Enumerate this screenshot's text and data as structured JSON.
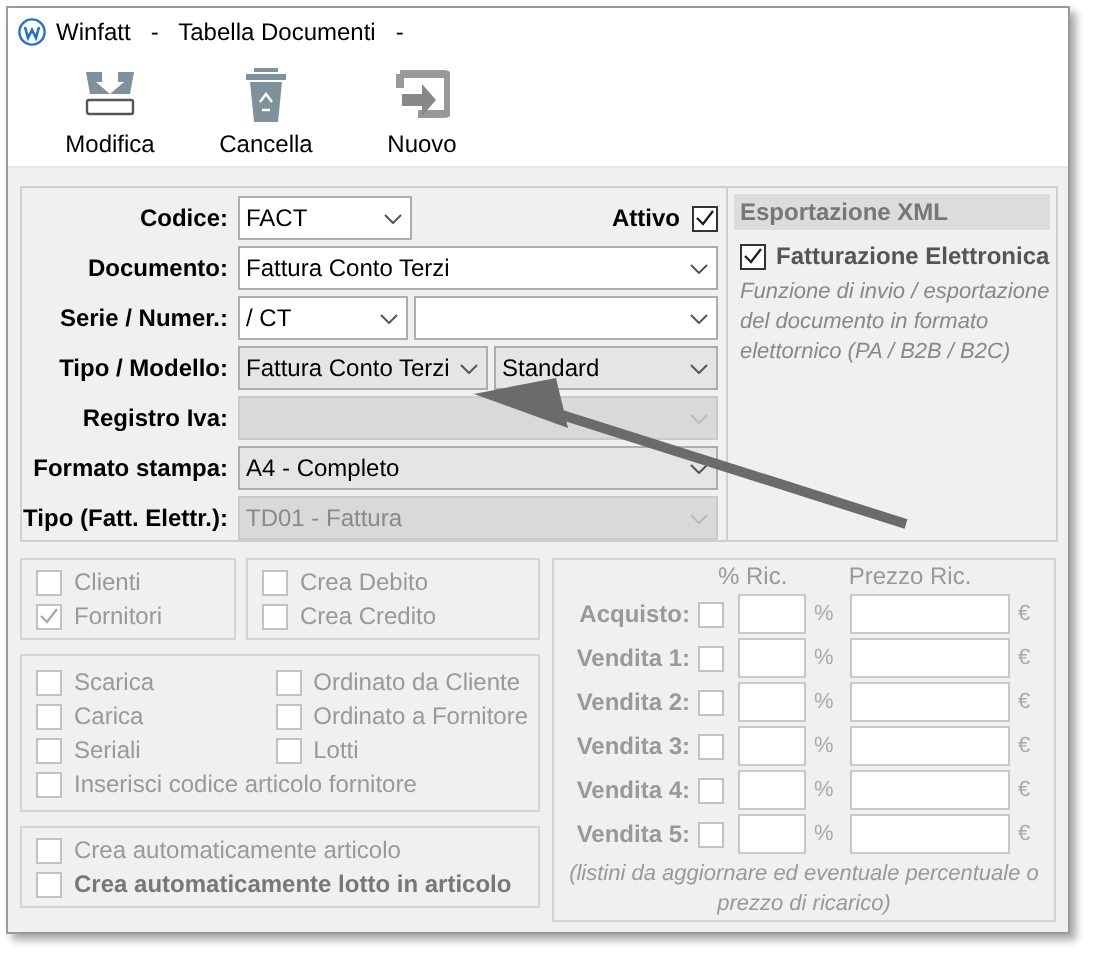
{
  "window": {
    "title": "Winfatt   -   Tabella Documenti   -"
  },
  "toolbar": [
    {
      "label": "Modifica"
    },
    {
      "label": "Cancella"
    },
    {
      "label": "Nuovo"
    }
  ],
  "fields": [
    {
      "label": "Codice:",
      "combos": [
        {
          "value": "FACT",
          "kind": "edit"
        }
      ],
      "checkbox": {
        "label": "Attivo",
        "checked": true
      }
    },
    {
      "label": "Documento:",
      "combos": [
        {
          "value": "Fattura Conto Terzi",
          "kind": "edit"
        }
      ]
    },
    {
      "label": "Serie / Numer.:",
      "combos": [
        {
          "value": "/ CT",
          "kind": "edit"
        },
        {
          "kind": "edit"
        }
      ]
    },
    {
      "label": "Tipo / Modello:",
      "combos": [
        {
          "value": "Fattura Conto Terzi",
          "kind": "list"
        },
        {
          "value": "Standard",
          "kind": "list"
        }
      ]
    },
    {
      "label": "Registro Iva:",
      "combos": [
        {
          "kind": "disabled"
        }
      ]
    },
    {
      "label": "Formato stampa:",
      "combos": [
        {
          "value": "A4 - Completo",
          "kind": "list"
        }
      ]
    },
    {
      "label": "Tipo (Fatt. Elettr.):",
      "combos": [
        {
          "value": "TD01 - Fattura",
          "kind": "disabled"
        }
      ]
    }
  ],
  "xml": {
    "title": "Esportazione XML",
    "option": {
      "label": "Fatturazione Elettronica",
      "checked": true
    },
    "note": "Funzione di invio / esportazione del documento in formato elettornico (PA / B2B / B2C)"
  },
  "groups": [
    {
      "items": [
        {
          "label": "Clienti",
          "checked": false
        },
        {
          "label": "Fornitori",
          "checked": true
        }
      ]
    },
    {
      "items": [
        {
          "label": "Crea Debito",
          "checked": false
        },
        {
          "label": "Crea Credito",
          "checked": false
        }
      ]
    },
    {
      "items": [
        {
          "label": "Scarica",
          "checked": false
        },
        {
          "label": "Ordinato da Cliente",
          "checked": false
        },
        {
          "label": "Carica",
          "checked": false
        },
        {
          "label": "Ordinato a Fornitore",
          "checked": false
        },
        {
          "label": "Seriali",
          "checked": false
        },
        {
          "label": "Lotti",
          "checked": false
        },
        {
          "label": "Inserisci codice articolo fornitore",
          "checked": false,
          "wide": true
        }
      ]
    },
    {
      "items": [
        {
          "label": "Crea automaticamente articolo",
          "checked": false
        },
        {
          "label": "Crea automaticamente lotto in articolo",
          "checked": false,
          "bold": true
        }
      ]
    }
  ],
  "pricing": {
    "columns": [
      "% Ric.",
      "Prezzo Ric."
    ],
    "rows": [
      {
        "label": "Acquisto:",
        "checked": false,
        "unit": "%",
        "currency": "€"
      },
      {
        "label": "Vendita 1:",
        "checked": false,
        "unit": "%",
        "currency": "€"
      },
      {
        "label": "Vendita 2:",
        "checked": false,
        "unit": "%",
        "currency": "€"
      },
      {
        "label": "Vendita 3:",
        "checked": false,
        "unit": "%",
        "currency": "€"
      },
      {
        "label": "Vendita 4:",
        "checked": false,
        "unit": "%",
        "currency": "€"
      },
      {
        "label": "Vendita 5:",
        "checked": false,
        "unit": "%",
        "currency": "€"
      }
    ],
    "note": "(listini da aggiornare ed eventuale percentuale o prezzo di ricarico)"
  }
}
